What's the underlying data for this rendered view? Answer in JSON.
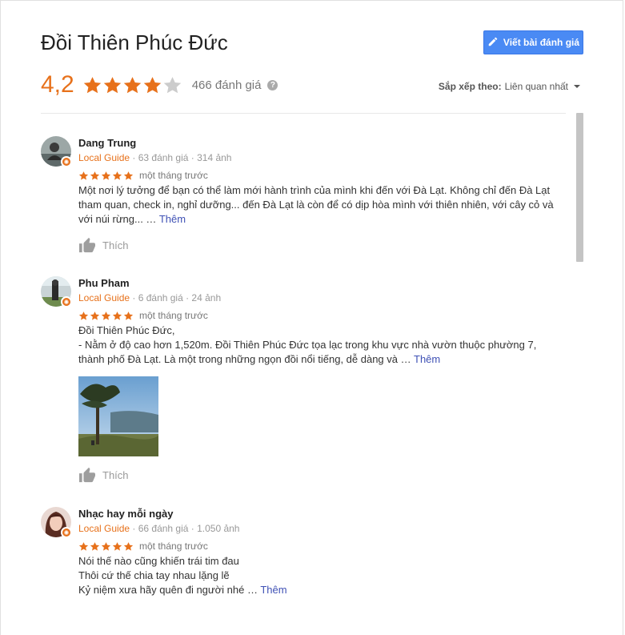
{
  "header": {
    "title": "Đồi Thiên Phúc Đức",
    "write_review_label": "Viết bài đánh giá",
    "rating": "4,2",
    "rating_value": 4.2,
    "review_count": "466 đánh giá",
    "sort_label": "Sắp xếp theo:",
    "sort_value": "Liên quan nhất"
  },
  "colors": {
    "accent": "#e7711b",
    "button": "#4a8af4",
    "link": "#3f51b5",
    "star_empty": "#cccccc"
  },
  "reviews": [
    {
      "name": "Dang Trung",
      "guide": "Local Guide",
      "stats": " · 63 đánh giá · 314 ảnh",
      "stars": 5,
      "time": "một tháng trước",
      "lines": [
        "Một nơi lý tưởng để bạn có thể làm mới hành trình của mình khi đến với Đà Lạt. Không chỉ đến Đà Lạt",
        "tham quan, check in, nghỉ dưỡng... đến Đà Lạt là còn để có dịp hòa mình với thiên nhiên, với cây cỏ và",
        "với núi rừng..."
      ],
      "ellipsis": " … ",
      "more": "Thêm",
      "like": "Thích"
    },
    {
      "name": "Phu Pham",
      "guide": "Local Guide",
      "stats": " · 6 đánh giá · 24 ảnh",
      "stars": 5,
      "time": "một tháng trước",
      "lines": [
        "Đồi Thiên Phúc Đức,",
        "- Nằm ở độ cao hơn 1,520m. Đồi Thiên Phúc Đức tọa lạc trong khu vực nhà vườn thuộc phường 7,",
        "thành phố Đà Lạt. Là một trong những ngọn đồi nổi tiếng, dễ dàng và"
      ],
      "ellipsis": " … ",
      "more": "Thêm",
      "like": "Thích"
    },
    {
      "name": "Nhạc hay mỗi ngày",
      "guide": "Local Guide",
      "stats": " · 66 đánh giá · 1.050 ảnh",
      "stars": 5,
      "time": "một tháng trước",
      "lines": [
        "Nói thế nào cũng khiến trái tim đau",
        "Thôi cứ thế chia tay nhau lặng lẽ",
        "Kỷ niệm xưa hãy quên đi người nhé"
      ],
      "ellipsis": " … ",
      "more": "Thêm"
    }
  ]
}
